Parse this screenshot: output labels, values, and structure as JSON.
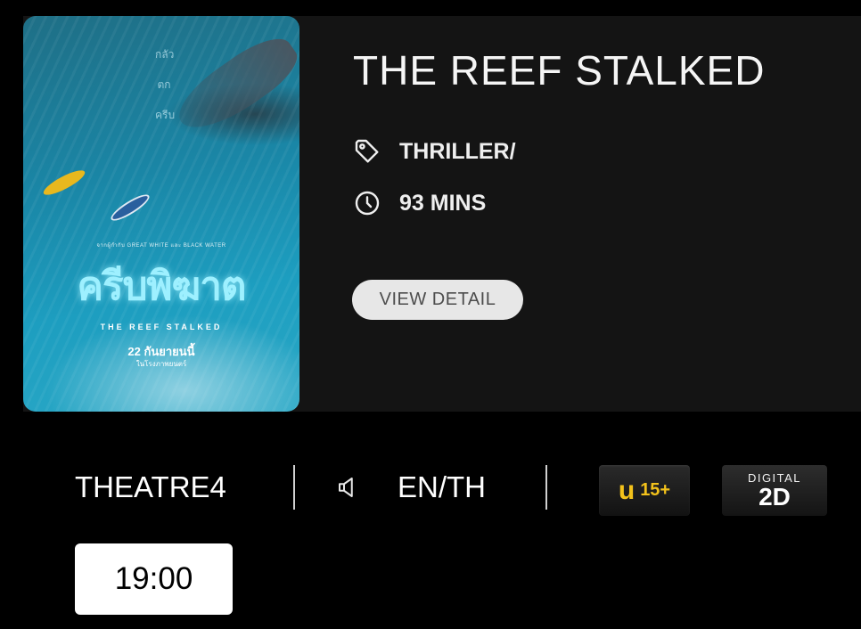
{
  "movie": {
    "title": "THE REEF STALKED",
    "genre": "THRILLER/",
    "duration": "93 MINS",
    "view_detail_label": "VIEW DETAIL",
    "poster": {
      "side_text": [
        "กลัว",
        "ตก",
        "ครีบ"
      ],
      "credits_line": "จากผู้กำกับ GREAT WHITE และ BLACK WATER",
      "thai_title": "ครีบพิฆาต",
      "english_title": "THE REEF STALKED",
      "release_date": "22 กันยายนนี้",
      "release_note": "ในโรงภาพยนตร์"
    }
  },
  "session": {
    "theatre": "THEATRE4",
    "language": "EN/TH",
    "rating_letter": "u",
    "rating_age": "15+",
    "format_top": "DIGITAL",
    "format_bottom": "2D",
    "showtime": "19:00"
  },
  "icons": {
    "genre": "tag-icon",
    "duration": "clock-icon",
    "language": "speaker-icon"
  },
  "colors": {
    "background": "#000000",
    "card": "#141414",
    "rating_accent": "#f3c21b",
    "button": "#e7e7e7"
  }
}
